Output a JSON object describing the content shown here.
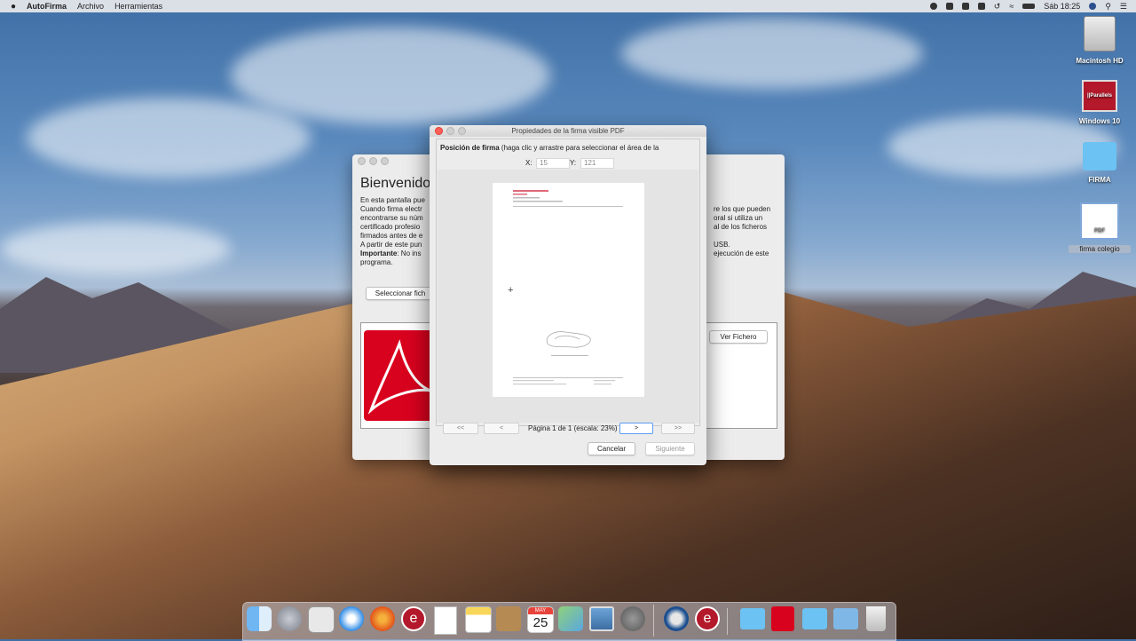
{
  "menubar": {
    "app": "AutoFirma",
    "items": [
      "Archivo",
      "Herramientas"
    ],
    "clock": "Sáb 18:25"
  },
  "desktop": {
    "icons": [
      {
        "label": "Macintosh HD"
      },
      {
        "label": "Windows 10"
      },
      {
        "label": "FIRMA"
      },
      {
        "label": "firma colegio",
        "file_type": "PDF"
      }
    ],
    "parallels_text": "||Parallels"
  },
  "welcome_window": {
    "title": "Bienvenido",
    "lines_left": [
      "En esta pantalla pue",
      "Cuando firma electr",
      "encontrarse su núm",
      "certificado profesio",
      "firmados antes de e",
      "A partir de este pun"
    ],
    "important_label": "Importante",
    "important_text": ": No ins",
    "last_line": "programa.",
    "lines_right": [
      "re los que pueden",
      "oral si utiliza un",
      "al de los ficheros",
      "USB.",
      "ejecución de este"
    ],
    "select_button": "Seleccionar fich",
    "view_button": "Ver Fichero"
  },
  "dialog": {
    "title": "Propiedades de la firma visible PDF",
    "position_label": "Posición de firma",
    "position_hint": " (haga clic y arrastre para seleccionar el área de la",
    "x_label": "X:",
    "x_value": "15",
    "y_label": "Y:",
    "y_value": "121",
    "nav": {
      "first": "<<",
      "prev": "<",
      "page_info": "Página 1 de 1 (escala: 23%)",
      "next": ">",
      "last": ">>"
    },
    "cancel_button": "Cancelar",
    "next_button": "Siguiente"
  },
  "dock": {
    "calendar_month": "MAY",
    "calendar_day": "25",
    "apps": [
      "finder",
      "launchpad",
      "screenshot",
      "safari",
      "firefox",
      "autofirma",
      "textedit",
      "notes",
      "contacts",
      "calendar",
      "maps",
      "preview",
      "system-preferences",
      "quicktime",
      "autofirma-2",
      "folder",
      "acrobat",
      "downloads",
      "applications",
      "trash"
    ]
  }
}
